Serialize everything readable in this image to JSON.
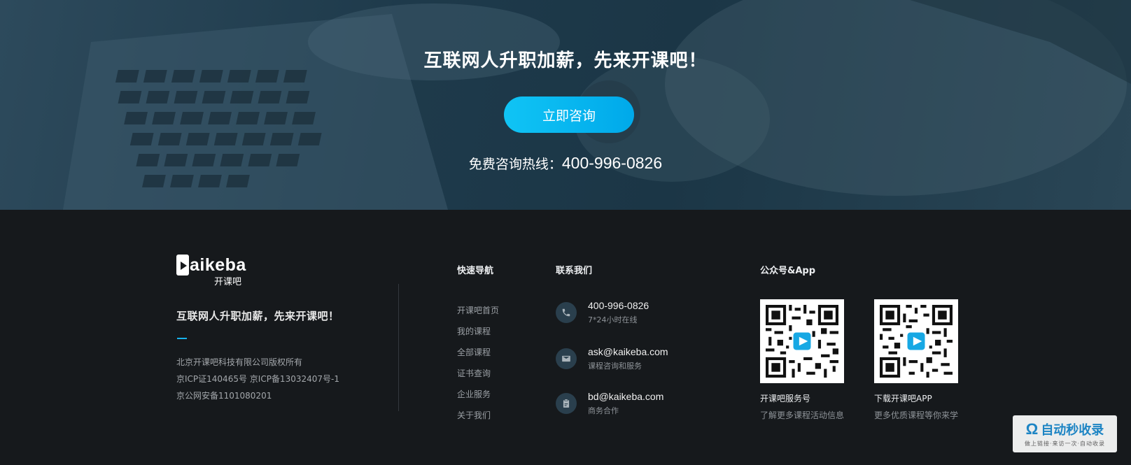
{
  "hero": {
    "title": "互联网人升职加薪，先来开课吧！",
    "cta_label": "立即咨询",
    "hotline_label": "免费咨询热线：",
    "hotline_number": "400-996-0826"
  },
  "brand": {
    "logo_text": "aikeba",
    "logo_sub": "开课吧",
    "tagline": "互联网人升职加薪，先来开课吧！",
    "legal": [
      "北京开课吧科技有限公司版权所有",
      "京ICP证140465号 京ICP备13032407号-1",
      "京公网安备1101080201"
    ]
  },
  "nav": {
    "title": "快速导航",
    "items": [
      "开课吧首页",
      "我的课程",
      "全部课程",
      "证书查询",
      "企业服务",
      "关于我们"
    ]
  },
  "contact": {
    "title": "联系我们",
    "items": [
      {
        "icon": "phone-icon",
        "main": "400-996-0826",
        "sub": "7*24小时在线"
      },
      {
        "icon": "mail-icon",
        "main": "ask@kaikeba.com",
        "sub": "课程咨询和服务"
      },
      {
        "icon": "clipboard-icon",
        "main": "bd@kaikeba.com",
        "sub": "商务合作"
      }
    ]
  },
  "apps": {
    "title": "公众号&App",
    "items": [
      {
        "title": "开课吧服务号",
        "sub": "了解更多课程活动信息"
      },
      {
        "title": "下载开课吧APP",
        "sub": "更多优质课程等你来学"
      }
    ]
  },
  "watermark": {
    "main": "自动秒收录",
    "sub": "做上链接·来访一次·自动收录"
  },
  "colors": {
    "accent": "#00b4f0",
    "footer_bg": "#16191c"
  }
}
